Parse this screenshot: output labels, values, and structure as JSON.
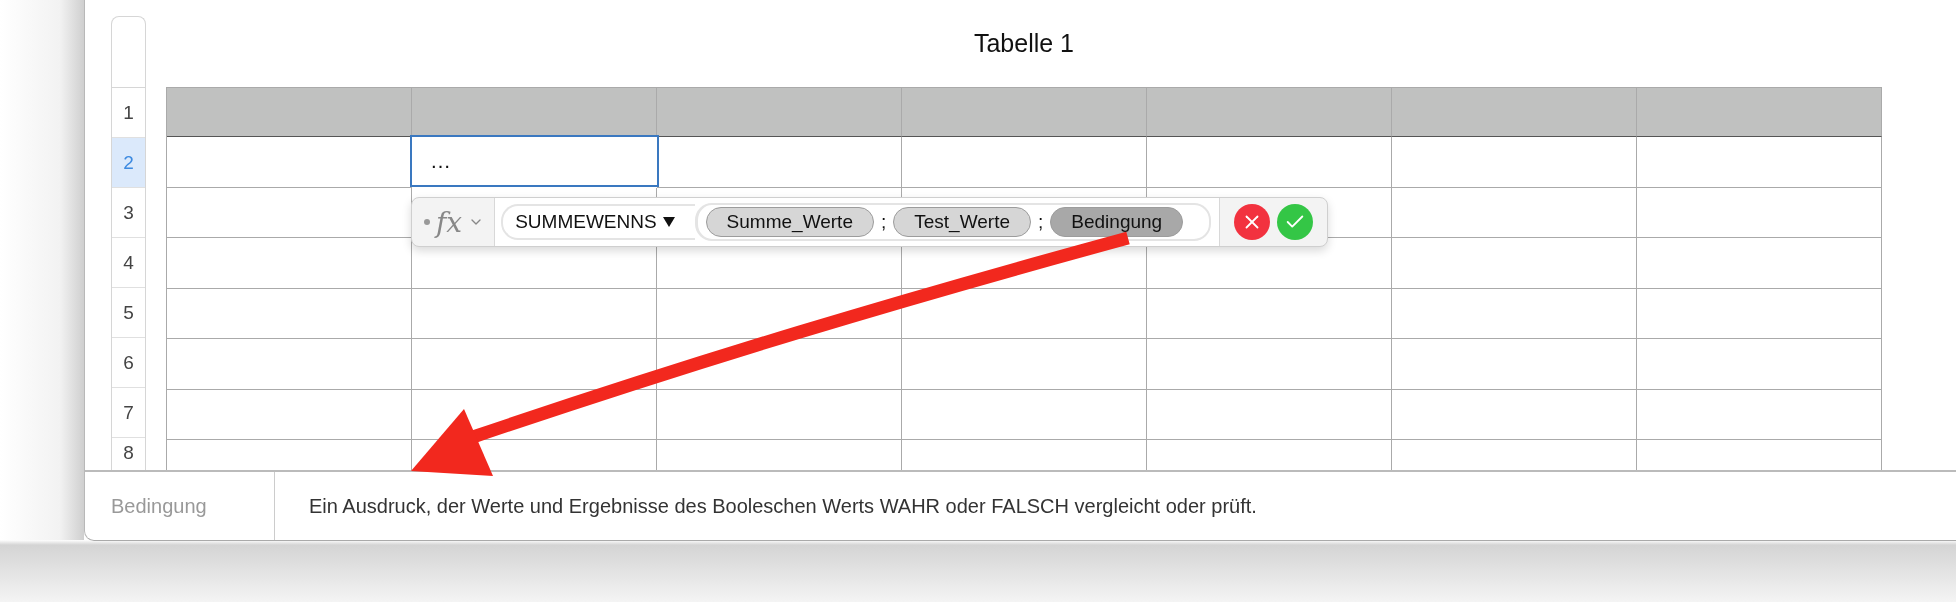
{
  "table": {
    "title": "Tabelle 1",
    "row_headers": [
      {
        "label": "1",
        "selected": false
      },
      {
        "label": "2",
        "selected": true
      },
      {
        "label": "3",
        "selected": false
      },
      {
        "label": "4",
        "selected": false
      },
      {
        "label": "5",
        "selected": false
      },
      {
        "label": "6",
        "selected": false
      },
      {
        "label": "7",
        "selected": false
      },
      {
        "label": "8",
        "selected": false
      }
    ],
    "active_cell": {
      "value": "…"
    }
  },
  "formula_editor": {
    "fx": "fx",
    "function": "SUMMEWENNS",
    "tokens": [
      {
        "kind": "argument",
        "label": "Summe_Werte",
        "selected": false
      },
      {
        "kind": "separator",
        "label": ";"
      },
      {
        "kind": "argument",
        "label": "Test_Werte",
        "selected": false
      },
      {
        "kind": "separator",
        "label": ";"
      },
      {
        "kind": "argument",
        "label": "Bedingung",
        "selected": true
      }
    ]
  },
  "help_bar": {
    "argument": "Bedingung",
    "description": "Ein Ausdruck, der Werte und Ergebnisse des Booleschen Werts WAHR oder FALSCH vergleicht oder prüft."
  }
}
